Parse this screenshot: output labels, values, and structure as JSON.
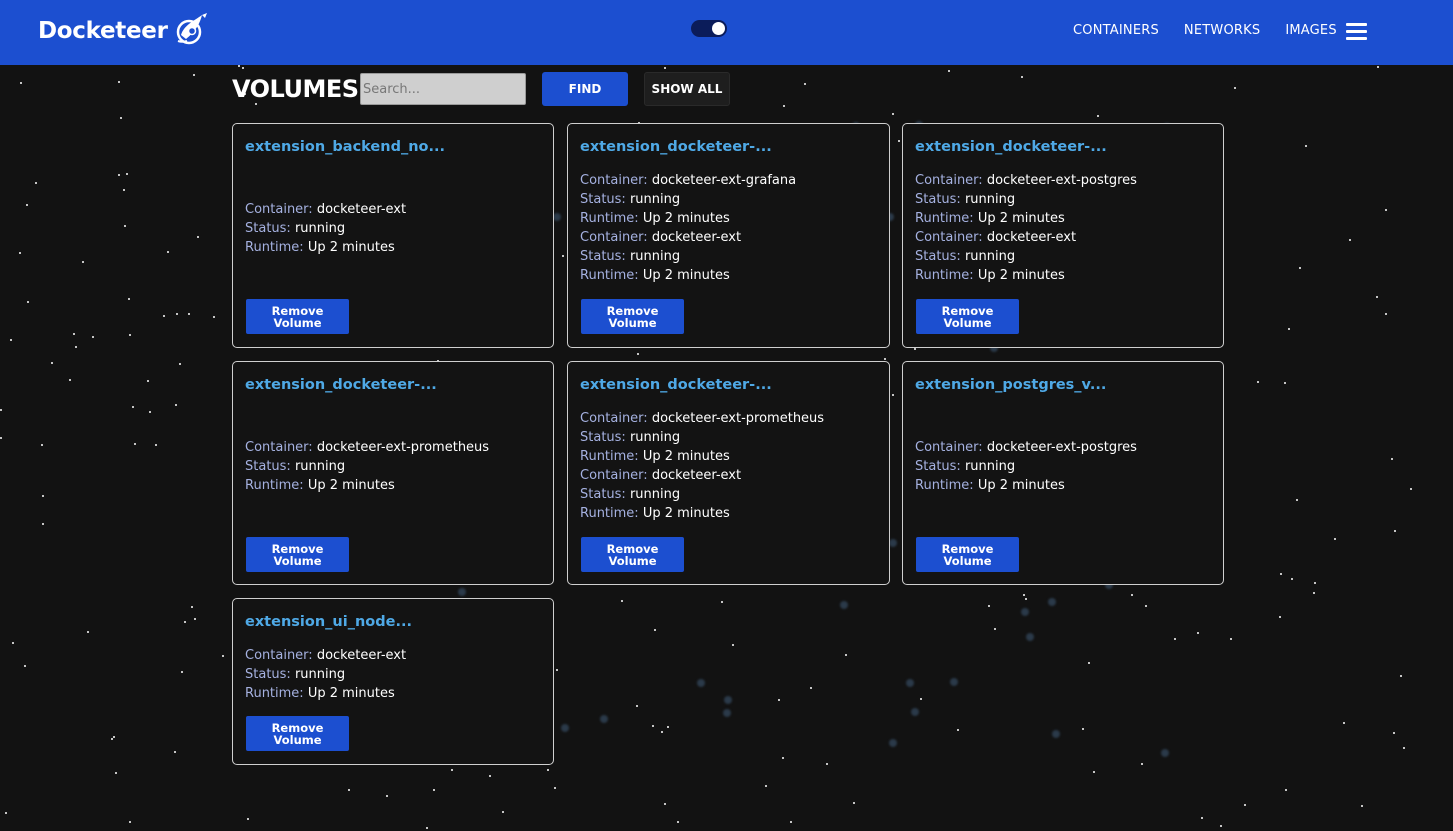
{
  "app": {
    "brand": "Docketeer",
    "nav": [
      "CONTAINERS",
      "NETWORKS",
      "IMAGES"
    ],
    "colors": {
      "header": "#1c4fd0",
      "background": "#121212",
      "title": "#4fa9e6",
      "label": "#a5b1e0"
    }
  },
  "toolbar": {
    "title": "VOLUMES",
    "search_placeholder": "Search...",
    "find_label": "FIND",
    "show_all_label": "SHOW ALL"
  },
  "labels": {
    "container": "Container:",
    "status": "Status:",
    "runtime": "Runtime:",
    "remove": "Remove Volume"
  },
  "volumes": [
    {
      "name": "extension_backend_no...",
      "containers": [
        {
          "container": "docketeer-ext",
          "status": "running",
          "runtime": "Up 2 minutes"
        }
      ]
    },
    {
      "name": "extension_docketeer-...",
      "containers": [
        {
          "container": "docketeer-ext-grafana",
          "status": "running",
          "runtime": "Up 2 minutes"
        },
        {
          "container": "docketeer-ext",
          "status": "running",
          "runtime": "Up 2 minutes"
        }
      ]
    },
    {
      "name": "extension_docketeer-...",
      "containers": [
        {
          "container": "docketeer-ext-postgres",
          "status": "running",
          "runtime": "Up 2 minutes"
        },
        {
          "container": "docketeer-ext",
          "status": "running",
          "runtime": "Up 2 minutes"
        }
      ]
    },
    {
      "name": "extension_docketeer-...",
      "containers": [
        {
          "container": "docketeer-ext-prometheus",
          "status": "running",
          "runtime": "Up 2 minutes"
        }
      ]
    },
    {
      "name": "extension_docketeer-...",
      "containers": [
        {
          "container": "docketeer-ext-prometheus",
          "status": "running",
          "runtime": "Up 2 minutes"
        },
        {
          "container": "docketeer-ext",
          "status": "running",
          "runtime": "Up 2 minutes"
        }
      ]
    },
    {
      "name": "extension_postgres_v...",
      "containers": [
        {
          "container": "docketeer-ext-postgres",
          "status": "running",
          "runtime": "Up 2 minutes"
        }
      ]
    },
    {
      "name": "extension_ui_node...",
      "containers": [
        {
          "container": "docketeer-ext",
          "status": "running",
          "runtime": "Up 2 minutes"
        }
      ]
    }
  ]
}
